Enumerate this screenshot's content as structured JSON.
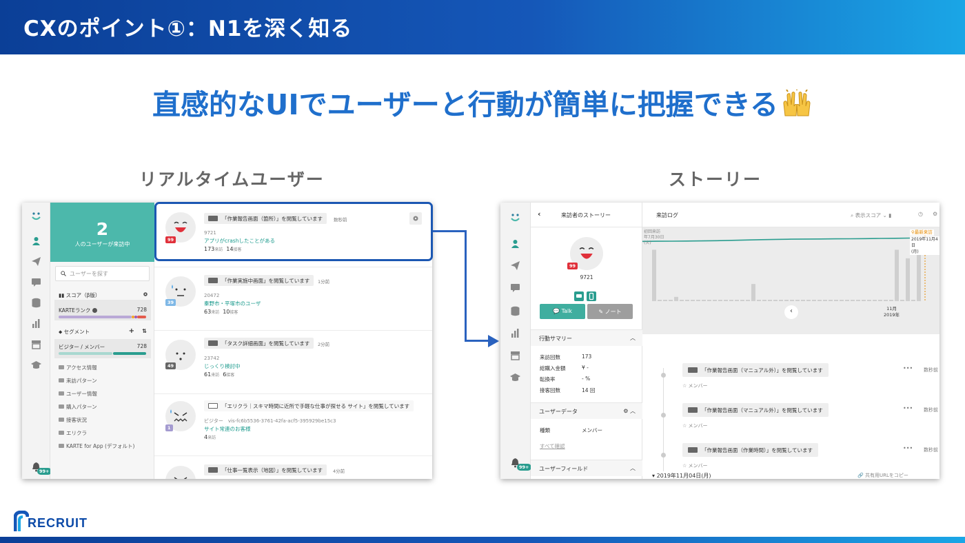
{
  "slide": {
    "title": "CXのポイント①：N1を深く知る",
    "headline": "直感的なUIでユーザーと行動が簡単に把握できる",
    "left_label": "リアルタイムユーザー",
    "right_label": "ストーリー",
    "logo_text": "RECRUIT"
  },
  "colors": {
    "brand_blue": "#1557b8",
    "headline_blue": "#1f6fcc",
    "teal": "#4cb8ab",
    "link_teal": "#1a9a8c"
  },
  "realtime": {
    "visitor_count": "2",
    "visitor_label": "人のユーザーが来訪中",
    "search_placeholder": "ユーザーを探す",
    "score_label": "スコア（β版）",
    "karte_rank_label": "KARTEランク",
    "karte_rank_value": "728",
    "segment_label": "セグメント",
    "segment_add": "+",
    "visitor_member_label": "ビジター / メンバー",
    "visitor_member_value": "728",
    "segment_groups": [
      "アクセス情報",
      "来訪パターン",
      "ユーザー情報",
      "購入パターン",
      "接客状況",
      "エリクラ",
      "KARTE for App (デフォルト)"
    ],
    "notifications_badge": "99+",
    "cards": [
      {
        "badge": "99",
        "page": "「作業報告画面（箇所）」を閲覧しています",
        "ago": "数秒前",
        "id": "9721",
        "link": "アプリがcrashしたことがある",
        "visits": "173",
        "visits_unit": "来訪",
        "contacts": "14",
        "contacts_unit": "接客"
      },
      {
        "badge": "39",
        "page": "「作業実施中画面」を閲覧しています",
        "ago": "1分前",
        "id": "20472",
        "link": "秦野市・平塚市のユーザ",
        "visits": "63",
        "visits_unit": "来訪",
        "contacts": "10",
        "contacts_unit": "接客"
      },
      {
        "badge": "49",
        "page": "「タスク詳細画面」を閲覧しています",
        "ago": "2分前",
        "id": "23742",
        "link": "じっくり検討中",
        "visits": "61",
        "visits_unit": "来訪",
        "contacts": "6",
        "contacts_unit": "接客"
      },
      {
        "badge": "1",
        "page": "「エリクラ｜スキマ時間に近所で手軽な仕事が探せる サイト」を閲覧しています",
        "ago": "",
        "id": "ビジター　vis-fc6b5536-3761-42fa-acf5-395929be15c3",
        "link": "サイト常連のお客様",
        "visits": "4",
        "visits_unit": "来訪",
        "contacts": "",
        "contacts_unit": ""
      },
      {
        "badge": "",
        "page": "「仕事一覧表示（地図）」を閲覧しています",
        "ago": "4分前",
        "id": "",
        "link": "",
        "visits": "",
        "visits_unit": "",
        "contacts": "",
        "contacts_unit": ""
      }
    ]
  },
  "story": {
    "panel_title": "来訪者のストーリー",
    "user_badge": "99",
    "user_id": "9721",
    "talk_button": "Talk",
    "note_button": "ノート",
    "summary_label": "行動サマリー",
    "summary": [
      {
        "key": "来訪回数",
        "value": "173"
      },
      {
        "key": "総購入金額",
        "value": "¥ -"
      },
      {
        "key": "転換率",
        "value": "- %"
      },
      {
        "key": "接客回数",
        "value": "14 回"
      }
    ],
    "userdata_label": "ユーザーデータ",
    "userdata_kind_key": "種類",
    "userdata_kind_value": "メンバー",
    "see_all": "すべて確認",
    "userfield_label": "ユーザーフィールド",
    "notifications_badge": "99+",
    "log_title": "来訪ログ",
    "display_score": "表示スコア",
    "first_visit_label": "初回来訪",
    "first_visit_date": "年7月30日",
    "first_visit_time": "(火)",
    "latest_visit_label": "最新来訪",
    "latest_visit_date": "2019年11月4日",
    "latest_visit_dow": "(月)",
    "axis_month": "11月",
    "axis_year": "2019年",
    "log_items": [
      {
        "text": "「作業報告画面（マニュアル外）」を閲覧しています",
        "sub": "メンバー",
        "more": "•••",
        "ago": "数秒前"
      },
      {
        "text": "「作業報告画面（マニュアル外）」を閲覧しています",
        "sub": "メンバー",
        "more": "•••",
        "ago": "数秒前"
      },
      {
        "text": "「作業報告画面（作業時間）」を閲覧しています",
        "sub": "メンバー",
        "more": "•••",
        "ago": "数秒前"
      }
    ],
    "date_header": "2019年11月04日(月)",
    "share_url": "共有用URLをコピー"
  },
  "chart_data": {
    "type": "bar",
    "title": "",
    "xlabel": "",
    "ylabel": "",
    "x_tick_labels": [
      "11月 2019年"
    ],
    "series": [
      {
        "values": [
          12,
          0,
          0,
          0,
          1,
          0,
          0,
          0,
          0,
          0,
          0,
          0,
          0,
          0,
          0,
          0,
          0,
          0,
          4,
          0,
          0,
          0,
          0,
          0,
          0,
          0,
          0,
          0,
          0,
          0,
          0,
          0,
          0,
          0,
          0,
          0,
          0,
          0,
          0,
          0,
          0,
          0,
          0,
          0,
          12,
          0,
          10,
          0,
          14
        ]
      }
    ],
    "line_values": [
      30,
      31,
      32,
      34,
      35,
      38,
      42,
      46,
      50,
      53,
      55,
      57,
      58,
      59,
      60,
      62,
      64,
      66,
      68,
      70,
      72
    ]
  }
}
